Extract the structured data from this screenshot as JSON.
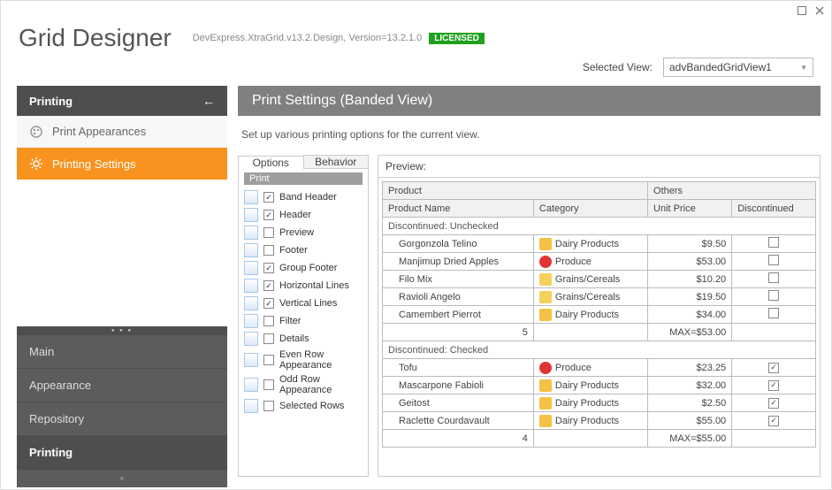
{
  "window": {
    "maximize_tip": "Maximize",
    "close_tip": "Close"
  },
  "header": {
    "app_title": "Grid Designer",
    "assembly": "DevExpress.XtraGrid.v13.2.Design, Version=13.2.1.0",
    "license_badge": "LICENSED",
    "selected_view_label": "Selected View:",
    "selected_view_value": "advBandedGridView1"
  },
  "sidebar": {
    "group_title": "Printing",
    "items": [
      {
        "label": "Print Appearances",
        "active": false
      },
      {
        "label": "Printing Settings",
        "active": true
      }
    ],
    "categories": [
      {
        "label": "Main"
      },
      {
        "label": "Appearance"
      },
      {
        "label": "Repository"
      },
      {
        "label": "Printing",
        "current": true
      }
    ]
  },
  "page": {
    "title": "Print Settings (Banded View)",
    "description": "Set up various printing options for the current view."
  },
  "tabs": {
    "options": "Options",
    "behavior": "Behavior"
  },
  "options": {
    "group_label": "Print",
    "items": [
      {
        "label": "Band Header",
        "checked": true
      },
      {
        "label": "Header",
        "checked": true
      },
      {
        "label": "Preview",
        "checked": false
      },
      {
        "label": "Footer",
        "checked": false
      },
      {
        "label": "Group Footer",
        "checked": true
      },
      {
        "label": "Horizontal Lines",
        "checked": true
      },
      {
        "label": "Vertical Lines",
        "checked": true
      },
      {
        "label": "Filter",
        "checked": false
      },
      {
        "label": "Details",
        "checked": false
      },
      {
        "label": "Even Row Appearance",
        "checked": false
      },
      {
        "label": "Odd Row Appearance",
        "checked": false
      },
      {
        "label": "Selected Rows",
        "checked": false
      }
    ]
  },
  "preview": {
    "label": "Preview:",
    "bands": [
      {
        "label": "Product",
        "span": 2
      },
      {
        "label": "Others",
        "span": 2
      }
    ],
    "columns": [
      "Product Name",
      "Category",
      "Unit Price",
      "Discontinued"
    ],
    "groups": [
      {
        "title": "Discontinued: Unchecked",
        "rows": [
          {
            "name": "Gorgonzola Telino",
            "category": "Dairy Products",
            "cat_icon": "dairy",
            "price": "$9.50",
            "discontinued": false
          },
          {
            "name": "Manjimup Dried Apples",
            "category": "Produce",
            "cat_icon": "produce",
            "price": "$53.00",
            "discontinued": false
          },
          {
            "name": "Filo Mix",
            "category": "Grains/Cereals",
            "cat_icon": "grain",
            "price": "$10.20",
            "discontinued": false
          },
          {
            "name": "Ravioli Angelo",
            "category": "Grains/Cereals",
            "cat_icon": "grain",
            "price": "$19.50",
            "discontinued": false
          },
          {
            "name": "Camembert Pierrot",
            "category": "Dairy Products",
            "cat_icon": "dairy",
            "price": "$34.00",
            "discontinued": false
          }
        ],
        "summary_count": "5",
        "summary_max": "MAX=$53.00"
      },
      {
        "title": "Discontinued: Checked",
        "rows": [
          {
            "name": "Tofu",
            "category": "Produce",
            "cat_icon": "produce",
            "price": "$23.25",
            "discontinued": true
          },
          {
            "name": "Mascarpone Fabioli",
            "category": "Dairy Products",
            "cat_icon": "dairy",
            "price": "$32.00",
            "discontinued": true
          },
          {
            "name": "Geitost",
            "category": "Dairy Products",
            "cat_icon": "dairy",
            "price": "$2.50",
            "discontinued": true
          },
          {
            "name": "Raclette Courdavault",
            "category": "Dairy Products",
            "cat_icon": "dairy",
            "price": "$55.00",
            "discontinued": true
          }
        ],
        "summary_count": "4",
        "summary_max": "MAX=$55.00"
      }
    ]
  }
}
